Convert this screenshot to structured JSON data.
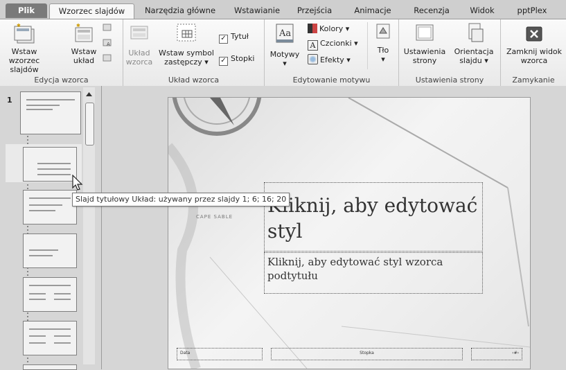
{
  "tabs": [
    "Plik",
    "Wzorzec slajdów",
    "Narzędzia główne",
    "Wstawianie",
    "Przejścia",
    "Animacje",
    "Recenzja",
    "Widok",
    "pptPlex"
  ],
  "groups": {
    "edycja": {
      "label": "Edycja wzorca",
      "insert_master": "Wstaw wzorzec slajdów",
      "insert_layout": "Wstaw układ"
    },
    "uklad": {
      "label": "Układ wzorca",
      "layout_master": "Układ wzorca",
      "insert_placeholder": "Wstaw symbol zastępczy",
      "title_cb": "Tytuł",
      "footer_cb": "Stopki"
    },
    "motyw": {
      "label": "Edytowanie motywu",
      "themes": "Motywy",
      "colors": "Kolory",
      "fonts": "Czcionki",
      "effects": "Efekty",
      "bg": "Tło"
    },
    "strona": {
      "label": "Ustawienia strony",
      "page_setup": "Ustawienia strony",
      "orientation": "Orientacja slajdu"
    },
    "zamknij": {
      "label": "Zamykanie",
      "close": "Zamknij widok wzorca"
    }
  },
  "slide_number": "1",
  "tooltip": "Slajd tytułowy Układ: używany przez slajdy 1; 6; 16; 20",
  "slide": {
    "title": "Kliknij, aby edytować styl",
    "subtitle": "Kliknij, aby edytować styl wzorca podtytułu",
    "footer_date": "Data",
    "footer_center": "Stopka",
    "footer_num": "‹#›",
    "map_text": "CAPE SABLE"
  },
  "colors": {
    "file_tab": "#7a7a7a",
    "close_btn": "#555555"
  }
}
